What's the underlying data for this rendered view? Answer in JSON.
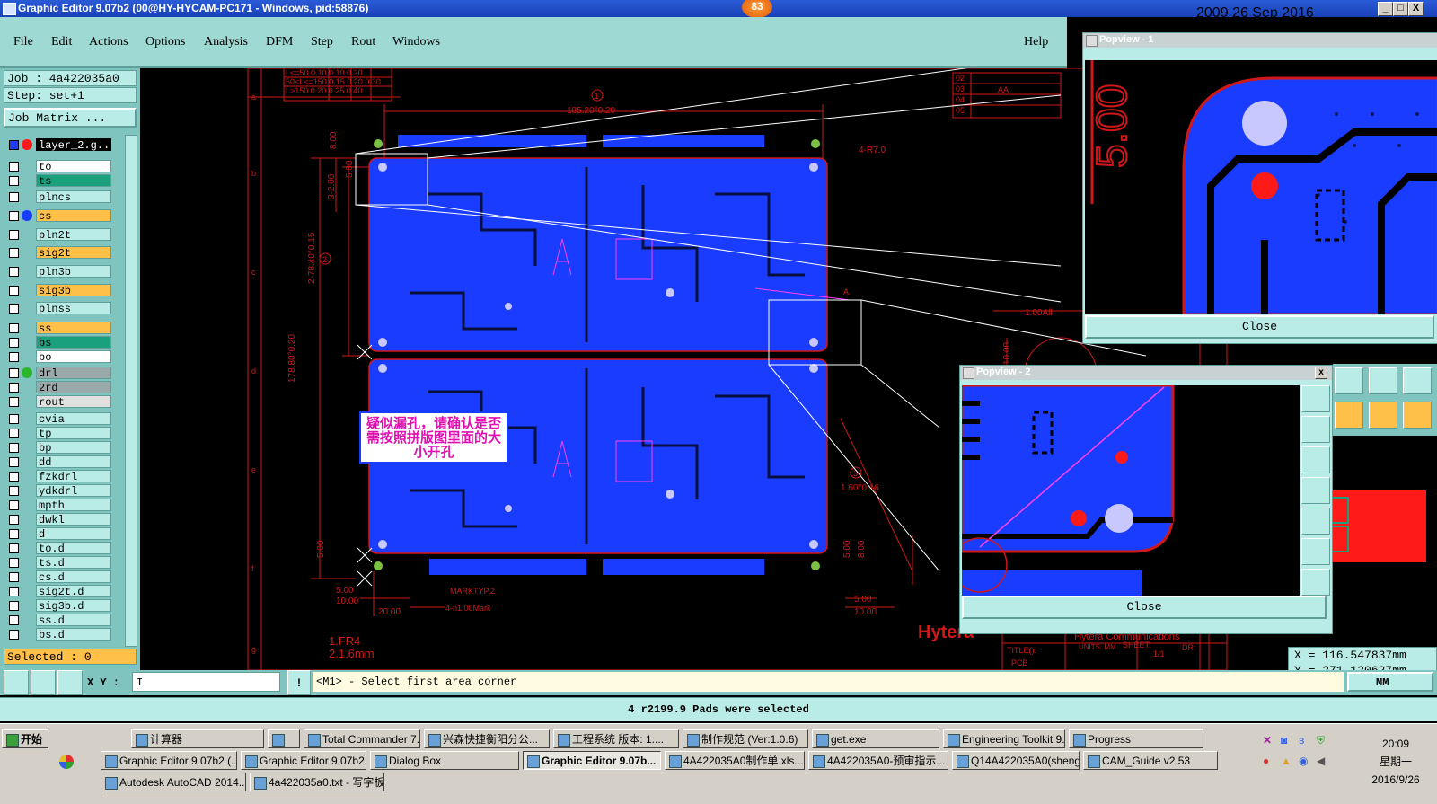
{
  "window": {
    "title": "Graphic Editor 9.07b2 (00@HY-HYCAM-PC171 - Windows, pid:58876)",
    "badge": "83",
    "min": "_",
    "max": "□",
    "close": "X"
  },
  "menu": {
    "items": [
      "File",
      "Edit",
      "Actions",
      "Options",
      "Analysis",
      "DFM",
      "Step",
      "Rout",
      "Windows"
    ],
    "help": "Help"
  },
  "job": {
    "job_line": "Job : 4a422035a0",
    "step_line": "Step: set+1",
    "matrix_btn": "Job Matrix ..."
  },
  "active_layer": "layer_2.g..",
  "layers": [
    {
      "name": "to",
      "color": "#ffffff",
      "dot": ""
    },
    {
      "name": "ts",
      "color": "#1aa07c",
      "dot": ""
    },
    {
      "name": "plncs",
      "color": "#b9ece7",
      "dot": ""
    },
    {
      "name": "cs",
      "color": "#ffc04a",
      "dot": "#1a3cff"
    },
    {
      "name": "pln2t",
      "color": "#b9ece7",
      "dot": ""
    },
    {
      "name": "sig2t",
      "color": "#ffc04a",
      "dot": ""
    },
    {
      "name": "pln3b",
      "color": "#b9ece7",
      "dot": ""
    },
    {
      "name": "sig3b",
      "color": "#ffc04a",
      "dot": ""
    },
    {
      "name": "plnss",
      "color": "#b9ece7",
      "dot": ""
    },
    {
      "name": "ss",
      "color": "#ffc04a",
      "dot": ""
    },
    {
      "name": "bs",
      "color": "#1aa07c",
      "dot": ""
    },
    {
      "name": "bo",
      "color": "#ffffff",
      "dot": ""
    },
    {
      "name": "drl",
      "color": "#9aa9a9",
      "dot": "#2bb52b"
    },
    {
      "name": "2rd",
      "color": "#9aa9a9",
      "dot": ""
    },
    {
      "name": "rout",
      "color": "#e0e0e0",
      "dot": ""
    },
    {
      "name": "cvia",
      "color": "#b9ece7",
      "dot": ""
    },
    {
      "name": "tp",
      "color": "#b9ece7",
      "dot": ""
    },
    {
      "name": "bp",
      "color": "#b9ece7",
      "dot": ""
    },
    {
      "name": "dd",
      "color": "#b9ece7",
      "dot": ""
    },
    {
      "name": "fzkdrl",
      "color": "#b9ece7",
      "dot": ""
    },
    {
      "name": "ydkdrl",
      "color": "#b9ece7",
      "dot": ""
    },
    {
      "name": "mpth",
      "color": "#b9ece7",
      "dot": ""
    },
    {
      "name": "dwkl",
      "color": "#b9ece7",
      "dot": ""
    },
    {
      "name": "d",
      "color": "#b9ece7",
      "dot": ""
    },
    {
      "name": "to.d",
      "color": "#b9ece7",
      "dot": ""
    },
    {
      "name": "ts.d",
      "color": "#b9ece7",
      "dot": ""
    },
    {
      "name": "cs.d",
      "color": "#b9ece7",
      "dot": ""
    },
    {
      "name": "sig2t.d",
      "color": "#b9ece7",
      "dot": ""
    },
    {
      "name": "sig3b.d",
      "color": "#b9ece7",
      "dot": ""
    },
    {
      "name": "ss.d",
      "color": "#b9ece7",
      "dot": ""
    },
    {
      "name": "bs.d",
      "color": "#b9ece7",
      "dot": ""
    }
  ],
  "selected": "Selected : 0",
  "drawing": {
    "dim_top": "185.20°0.20",
    "dim_left1": "2-78.40°0.15",
    "dim_left2": "178.80°0.20",
    "dim_left3": "3-2.00",
    "dim_500": "5.00",
    "dim_800": "8.00",
    "dim_r70": "4-R7.0",
    "dim_160": "1.60°0.16",
    "dim_100all": "1.00All",
    "dim_1000": "10.00",
    "dim_2000": "20.00",
    "marktyp": "MARKTYP.2",
    "mark": "4-n1.00Mark",
    "fr4": "1.FR4",
    "thick": "2.1.6mm",
    "note": "疑似漏孔，请确认是否需按照拼版图里面的大小开孔",
    "hytera": "Hytera",
    "company": "Hytera Communications",
    "title_lbl": "TITLE():",
    "pcb_lbl": "PCB",
    "sheet_lbl": "SHEET:",
    "sheet_val": "1/1",
    "dr_lbl": "DR:",
    "unit_lbl": "UNITS: MM",
    "table_rows": [
      "L<=50 0.10 0.10 0.20",
      "50<L<=150 0.15 0.20 0.30",
      "L>150 0.20 0.25 0.40"
    ],
    "circle1": "1",
    "circle2": "2",
    "circle3": "3",
    "letterA": "A",
    "row_labels": [
      "a",
      "b",
      "c",
      "d",
      "e",
      "f",
      "g"
    ],
    "rev_rows": [
      "02",
      "03",
      "04",
      "05"
    ],
    "rev_aa": "AA",
    "header_right": "2009 26 Sep 2016"
  },
  "popview1": {
    "title": "Popview - 1",
    "close": "Close",
    "big_text": "5.00"
  },
  "popview2": {
    "title": "Popview - 2",
    "close": "Close"
  },
  "coords": {
    "x": "X = 116.547837mm",
    "y": "Y = 271.120627mm"
  },
  "cmd": {
    "xy_label": "X Y :",
    "xy_value": "I",
    "prompt": "<M1> - Select first area corner",
    "units": "MM"
  },
  "status": "4 r2199.9 Pads were selected",
  "taskbar": {
    "start": "开始",
    "row1": [
      "计算器",
      "",
      "Total Commander 7.0 ...",
      "兴森快捷衡阳分公...",
      "工程系统 版本: 1....",
      "制作规范 (Ver:1.0.6)",
      "get.exe",
      "Engineering Toolkit 9....",
      "Progress"
    ],
    "row2": [
      "Graphic Editor 9.07b2 (...",
      "Graphic Editor 9.07b2 (...",
      "Dialog Box",
      "Graphic Editor 9.07b...",
      "4A422035A0制作单.xls...",
      "4A422035A0-预审指示...",
      "Q14A422035A0(shengc...",
      "CAM_Guide v2.53"
    ],
    "row3": [
      "Autodesk AutoCAD 2014...",
      "4a422035a0.txt - 写字板"
    ],
    "time": "20:09",
    "weekday": "星期一",
    "date": "2016/9/26"
  }
}
